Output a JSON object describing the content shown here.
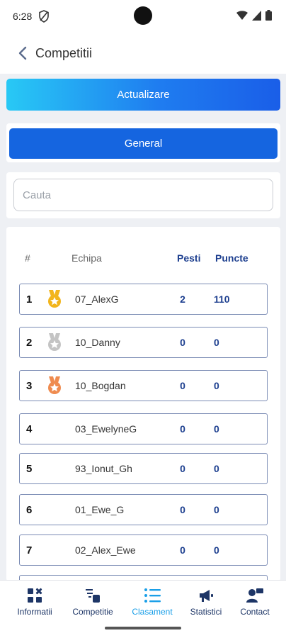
{
  "status_bar": {
    "time": "6:28"
  },
  "app_bar": {
    "title": "Competitii"
  },
  "actions": {
    "refresh_label": "Actualizare"
  },
  "tabs": {
    "general_label": "General"
  },
  "search": {
    "placeholder": "Cauta",
    "value": ""
  },
  "table": {
    "headers": {
      "rank": "#",
      "team": "Echipa",
      "fish": "Pesti",
      "points": "Puncte"
    },
    "rows": [
      {
        "rank": "1",
        "team": "07_AlexG",
        "fish": "2",
        "points": "110",
        "medal": "gold"
      },
      {
        "rank": "2",
        "team": "10_Danny",
        "fish": "0",
        "points": "0",
        "medal": "silver"
      },
      {
        "rank": "3",
        "team": "10_Bogdan",
        "fish": "0",
        "points": "0",
        "medal": "bronze"
      },
      {
        "rank": "4",
        "team": "03_EwelyneG",
        "fish": "0",
        "points": "0",
        "medal": ""
      },
      {
        "rank": "5",
        "team": "93_Ionut_Gh",
        "fish": "0",
        "points": "0",
        "medal": ""
      },
      {
        "rank": "6",
        "team": "01_Ewe_G",
        "fish": "0",
        "points": "0",
        "medal": ""
      },
      {
        "rank": "7",
        "team": "02_Alex_Ewe",
        "fish": "0",
        "points": "0",
        "medal": ""
      }
    ]
  },
  "colors": {
    "gold": "#f2b51c",
    "silver": "#c4c4c4",
    "bronze": "#ef8b4f",
    "accent": "#1a9fe8",
    "navy": "#1d3f8f"
  },
  "bottom_nav": {
    "items": [
      {
        "label": "Informatii",
        "icon": "dashboard-icon",
        "active": false
      },
      {
        "label": "Competitie",
        "icon": "competition-icon",
        "active": false
      },
      {
        "label": "Clasament",
        "icon": "list-icon",
        "active": true
      },
      {
        "label": "Statistici",
        "icon": "megaphone-icon",
        "active": false
      },
      {
        "label": "Contact",
        "icon": "contact-icon",
        "active": false
      }
    ]
  }
}
